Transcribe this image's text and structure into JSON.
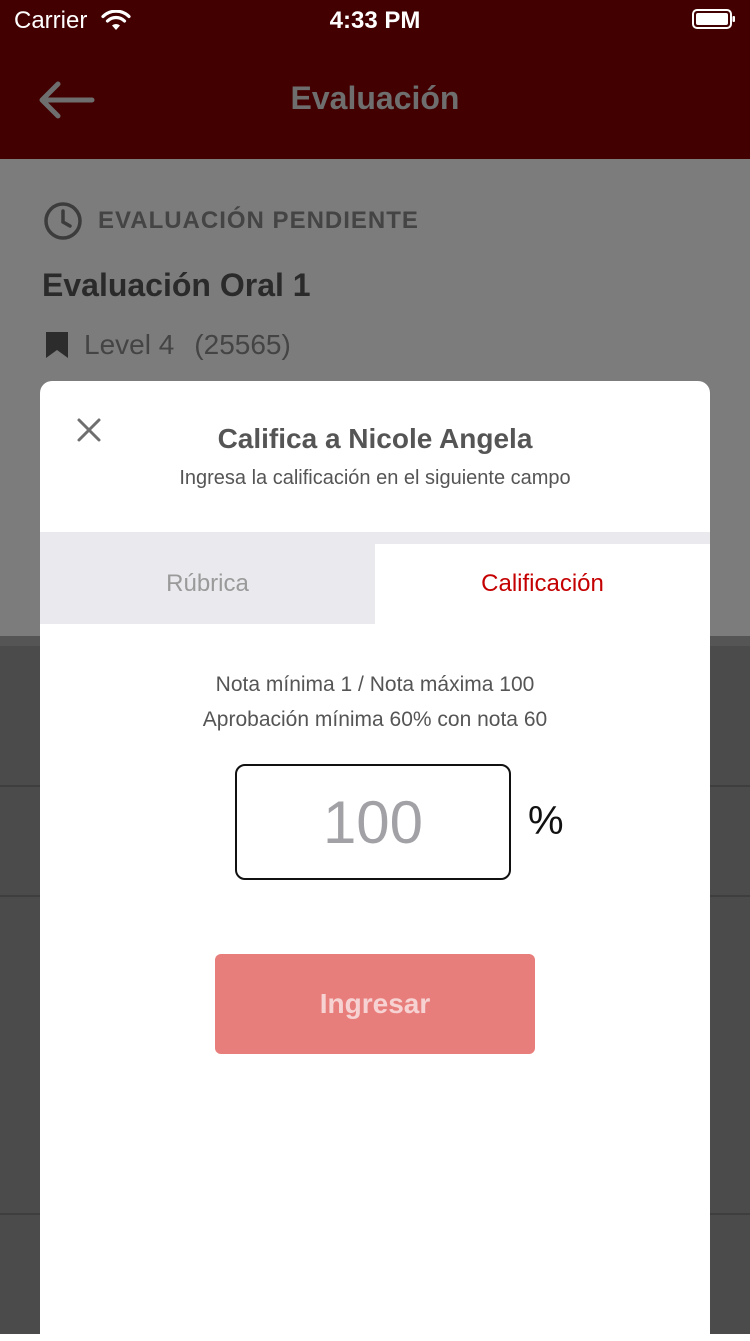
{
  "status_bar": {
    "carrier": "Carrier",
    "time": "4:33 PM"
  },
  "nav": {
    "title": "Evaluación",
    "back_icon": "arrow-left-icon"
  },
  "page": {
    "status_icon": "clock-icon",
    "status_label": "EVALUACIÓN PENDIENTE",
    "evaluation_title": "Evaluación Oral 1",
    "level_icon": "bookmark-icon",
    "level_name": "Level 4",
    "level_code": "(25565)"
  },
  "modal": {
    "close_icon": "close-icon",
    "title": "Califica a Nicole Angela",
    "subtitle": "Ingresa la calificación en el siguiente campo",
    "tabs": [
      {
        "label": "Rúbrica",
        "active": false
      },
      {
        "label": "Calificación",
        "active": true
      }
    ],
    "grade_range": "Nota mínima 1 / Nota máxima 100",
    "approval": "Aprobación mínima 60% con nota 60",
    "grade_input": {
      "value": "",
      "placeholder": "100"
    },
    "percent_symbol": "%",
    "submit_label": "Ingresar"
  },
  "colors": {
    "header_bg": "#420000",
    "active_tab": "#c40000",
    "submit_bg": "#e87e7c"
  }
}
